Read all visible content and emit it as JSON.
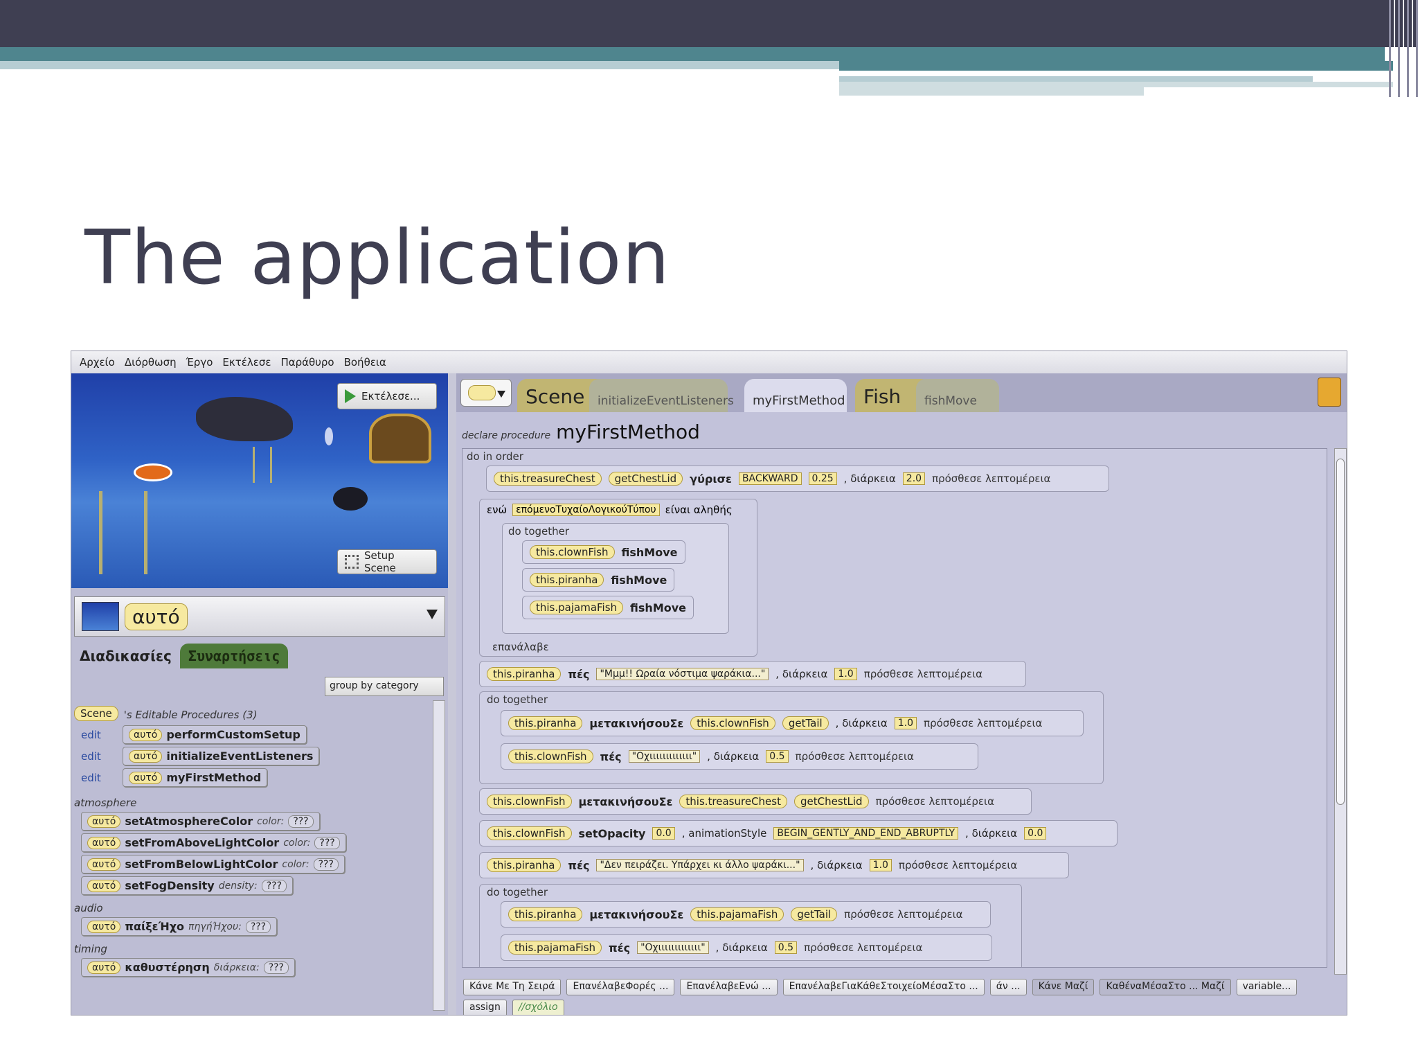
{
  "slide": {
    "title": "The application"
  },
  "menu": [
    "Αρχείο",
    "Διόρθωση",
    "Έργο",
    "Εκτέλεσε",
    "Παράθυρο",
    "Βοήθεια"
  ],
  "scene": {
    "run_label": "Εκτέλεσε...",
    "setup_label": "Setup Scene"
  },
  "object_selector": {
    "value": "αυτό"
  },
  "left_tabs": {
    "procedures": "Διαδικασίες",
    "functions": "Συναρτήσεις"
  },
  "group_select": {
    "value": "group by category"
  },
  "palette": {
    "scene_pill": "Scene",
    "editable_header": "'s Editable Procedures (3)",
    "edit_label": "edit",
    "self": "αυτό",
    "editable": [
      "performCustomSetup",
      "initializeEventListeners",
      "myFirstMethod"
    ],
    "atmosphere_label": "atmosphere",
    "atmosphere": [
      {
        "name": "setAtmosphereColor",
        "param": "color:"
      },
      {
        "name": "setFromAboveLightColor",
        "param": "color:"
      },
      {
        "name": "setFromBelowLightColor",
        "param": "color:"
      },
      {
        "name": "setFogDensity",
        "param": "density:"
      }
    ],
    "audio_label": "audio",
    "audio": [
      {
        "name": "παίξεΉχο",
        "param": "πηγήΉχου:"
      }
    ],
    "timing_label": "timing",
    "timing": [
      {
        "name": "καθυστέρηση",
        "param": "διάρκεια:"
      }
    ],
    "qq": "???"
  },
  "editor": {
    "tabs": {
      "scene": "Scene",
      "init": "initializeEventListeners",
      "my": "myFirstMethod",
      "fish": "Fish",
      "fishmove": "fishMove"
    },
    "declare_label": "declare procedure",
    "method_name": "myFirstMethod",
    "do_in_order": "do in order",
    "do_together": "do together",
    "while_label": "ενώ",
    "while_cond": "επόμενοΤυχαίοΛογικούΤύπου",
    "while_true": "είναι αληθής",
    "repeat_label": "επανάλαβε",
    "more": "πρόσθεσε λεπτομέρεια",
    "duration": ", διάρκεια",
    "lines": {
      "l1_obj": "this.treasureChest",
      "l1_fn": "getChestLid",
      "l1_verb": "γύρισε",
      "l1_dir": "BACKWARD",
      "l1_amt": "0.25",
      "l1_dur": "2.0",
      "f1": "this.clownFish",
      "f2": "this.piranha",
      "f3": "this.pajamaFish",
      "fishMove": "fishMove",
      "say": "πές",
      "l3_text": "\"Μμμ!! Ωραία νόστιμα ψαράκια...\"",
      "l3_dur": "1.0",
      "moveTo": "μετακινήσουΣε",
      "getTail": "getTail",
      "l4_dur": "1.0",
      "l5_text": "\"Οχιιιιιιιιιιιιι\"",
      "l5_dur": "0.5",
      "l6_target": "this.treasureChest",
      "l6_fn": "getChestLid",
      "setOpacity": "setOpacity",
      "l7_val": "0.0",
      "l7_anim": ", animationStyle",
      "l7_style": "BEGIN_GENTLY_AND_END_ABRUPTLY",
      "l7_dur": "0.0",
      "l8_text": "\"Δεν πειράζει. Υπάρχει κι άλλο ψαράκι...\"",
      "l8_dur": "1.0",
      "l10_text": "\"Οχιιιιιιιιιιιιι\"",
      "l10_dur": "0.5"
    }
  },
  "bottom": [
    "Κάνε Με Τη Σειρά",
    "ΕπανέλαβεΦορές ...",
    "ΕπανέλαβεΕνώ ...",
    "ΕπανέλαβεΓιαΚάθεΣτοιχείοΜέσαΣτο ...",
    "άν ...",
    "Κάνε Μαζί",
    "ΚαθέναΜέσαΣτο ... Μαζί",
    "variable...",
    "assign",
    "//σχόλιο"
  ]
}
